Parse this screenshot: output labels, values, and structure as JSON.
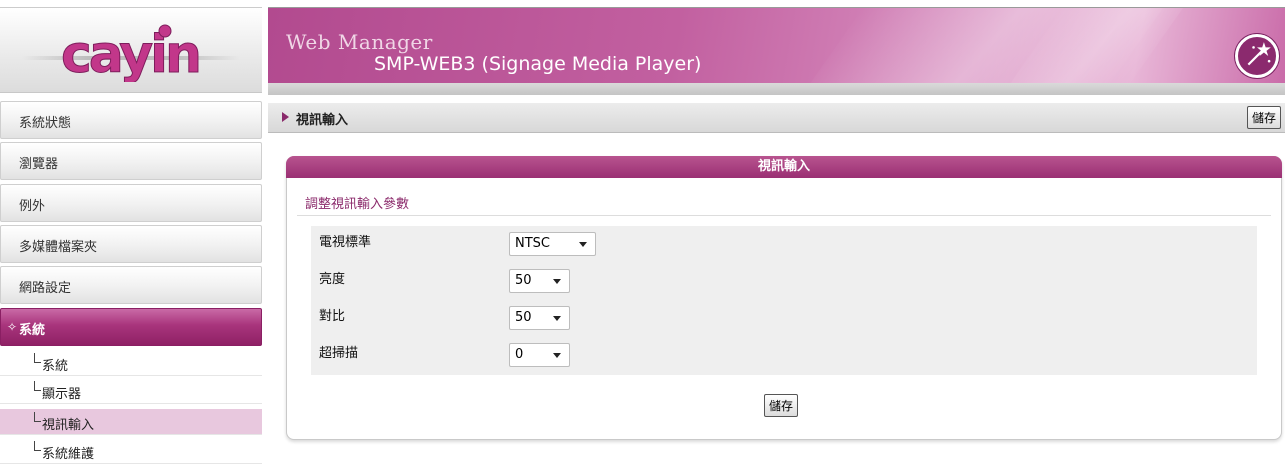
{
  "header": {
    "app_title": "Web Manager",
    "subtitle": "SMP-WEB3 (Signage Media Player)",
    "brand_color": "#b24a8f"
  },
  "logo": {
    "text": "cayin"
  },
  "sidebar": {
    "items": [
      {
        "label": "系統狀態"
      },
      {
        "label": "瀏覽器"
      },
      {
        "label": "例外"
      },
      {
        "label": "多媒體檔案夾"
      },
      {
        "label": "網路設定"
      },
      {
        "label": "系統",
        "active": true
      }
    ],
    "sub_items": [
      {
        "label": "系統"
      },
      {
        "label": "顯示器"
      },
      {
        "label": "視訊輸入",
        "selected": true
      },
      {
        "label": "系統維護"
      }
    ]
  },
  "breadcrumb": {
    "text": "視訊輸入"
  },
  "toolbar": {
    "save_label": "儲存"
  },
  "panel": {
    "title": "視訊輸入",
    "description": "調整視訊輸入參數",
    "fields": [
      {
        "label": "電視標準",
        "value": "NTSC"
      },
      {
        "label": "亮度",
        "value": "50"
      },
      {
        "label": "對比",
        "value": "50"
      },
      {
        "label": "超掃描",
        "value": "0"
      }
    ],
    "save_label": "儲存"
  }
}
